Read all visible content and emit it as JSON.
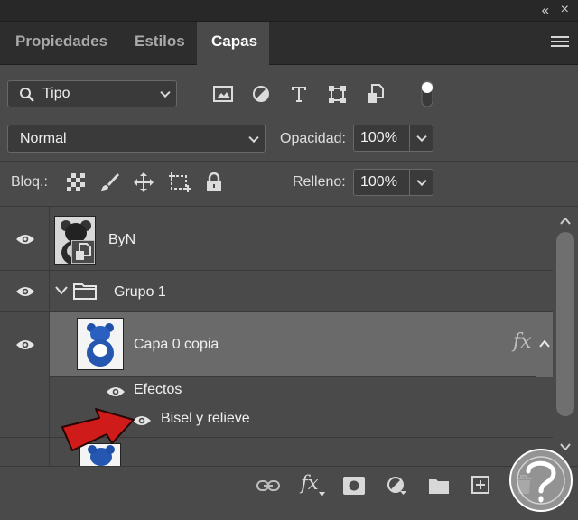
{
  "window": {
    "collapse_glyph": "«",
    "close_glyph": "×"
  },
  "tabs": [
    {
      "label": "Propiedades",
      "active": false
    },
    {
      "label": "Estilos",
      "active": false
    },
    {
      "label": "Capas",
      "active": true
    }
  ],
  "filter": {
    "kind_label": "Tipo",
    "icons": [
      "image-filter-icon",
      "adjustment-filter-icon",
      "type-filter-icon",
      "shape-filter-icon",
      "smart-object-filter-icon",
      "filter-toggle-icon"
    ]
  },
  "blend": {
    "mode": "Normal",
    "opacity_label": "Opacidad:",
    "opacity_value": "100%"
  },
  "lock": {
    "label": "Bloq.:",
    "fill_label": "Relleno:",
    "fill_value": "100%"
  },
  "layers": [
    {
      "name": "ByN",
      "type": "smart-object"
    },
    {
      "name": "Grupo 1",
      "type": "group",
      "expanded": true
    },
    {
      "name": "Capa 0 copia",
      "type": "pixel",
      "selected": true,
      "fx": "fx"
    },
    {
      "name": "Efectos",
      "type": "effects-header"
    },
    {
      "name": "Bisel y relieve",
      "type": "effect"
    }
  ],
  "colors": {
    "panel_bg": "#4a4a4a",
    "selected_row": "#6a6a6a",
    "arrow_red": "#d01b1b",
    "watermark_bg": "#a0a0a0"
  }
}
